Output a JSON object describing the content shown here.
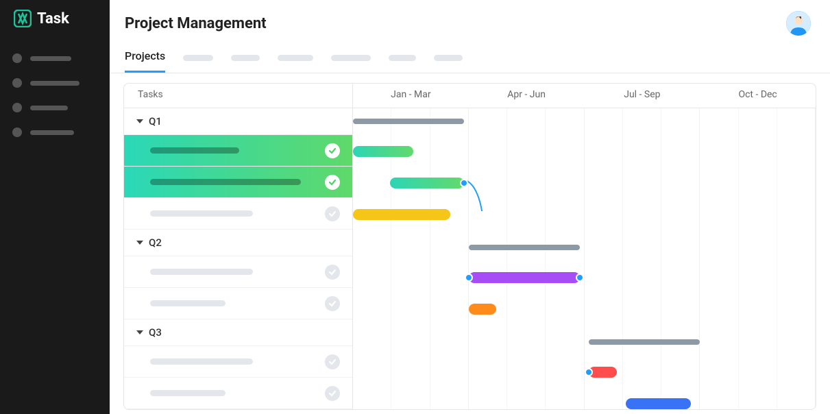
{
  "app": {
    "name": "Task",
    "logoColor": "#1fc39b"
  },
  "header": {
    "title": "Project Management"
  },
  "tabs": {
    "active": "Projects",
    "placeholders": [
      44,
      42,
      52,
      58,
      40,
      42
    ]
  },
  "gantt": {
    "tasksLabel": "Tasks",
    "quarters": [
      "Jan - Mar",
      "Apr - Jun",
      "Jul - Sep",
      "Oct - Dec"
    ],
    "groups": [
      {
        "name": "Q1",
        "summary": {
          "start": 0,
          "width": 24
        },
        "tasks": [
          {
            "done": true,
            "barWidth": 130,
            "color": "gradient-teal-green",
            "start": 0,
            "width": 13
          },
          {
            "done": true,
            "barWidth": 220,
            "color": "gradient-teal-green",
            "start": 8,
            "width": 16
          },
          {
            "done": false,
            "barWidth": 150,
            "color": "yellow",
            "start": 0,
            "width": 21
          }
        ]
      },
      {
        "name": "Q2",
        "summary": {
          "start": 25,
          "width": 24
        },
        "tasks": [
          {
            "done": false,
            "barWidth": 150,
            "color": "purple",
            "start": 25,
            "width": 24
          },
          {
            "done": false,
            "barWidth": 110,
            "color": "orange",
            "start": 25,
            "width": 6
          }
        ]
      },
      {
        "name": "Q3",
        "summary": {
          "start": 51,
          "width": 24
        },
        "tasks": [
          {
            "done": false,
            "barWidth": 150,
            "color": "red",
            "start": 51,
            "width": 6
          },
          {
            "done": false,
            "barWidth": 110,
            "color": "blue",
            "start": 59,
            "width": 14
          }
        ]
      }
    ],
    "dependencies": [
      {
        "from": {
          "x": 24,
          "row": 2
        },
        "to": {
          "x": 25,
          "row": 5
        }
      },
      {
        "from": {
          "x": 49,
          "row": 5
        },
        "to": {
          "x": 51,
          "row": 8
        }
      }
    ]
  },
  "colors": {
    "gradient-teal-green": "linear-gradient(90deg, #2cd5b6 0%, #63d96c 100%)",
    "yellow": "#f5c518",
    "purple": "#a64df5",
    "orange": "#ff8c1a",
    "red": "#ff4d4d",
    "blue": "#3a72f5",
    "summary": "#8e99a6"
  }
}
